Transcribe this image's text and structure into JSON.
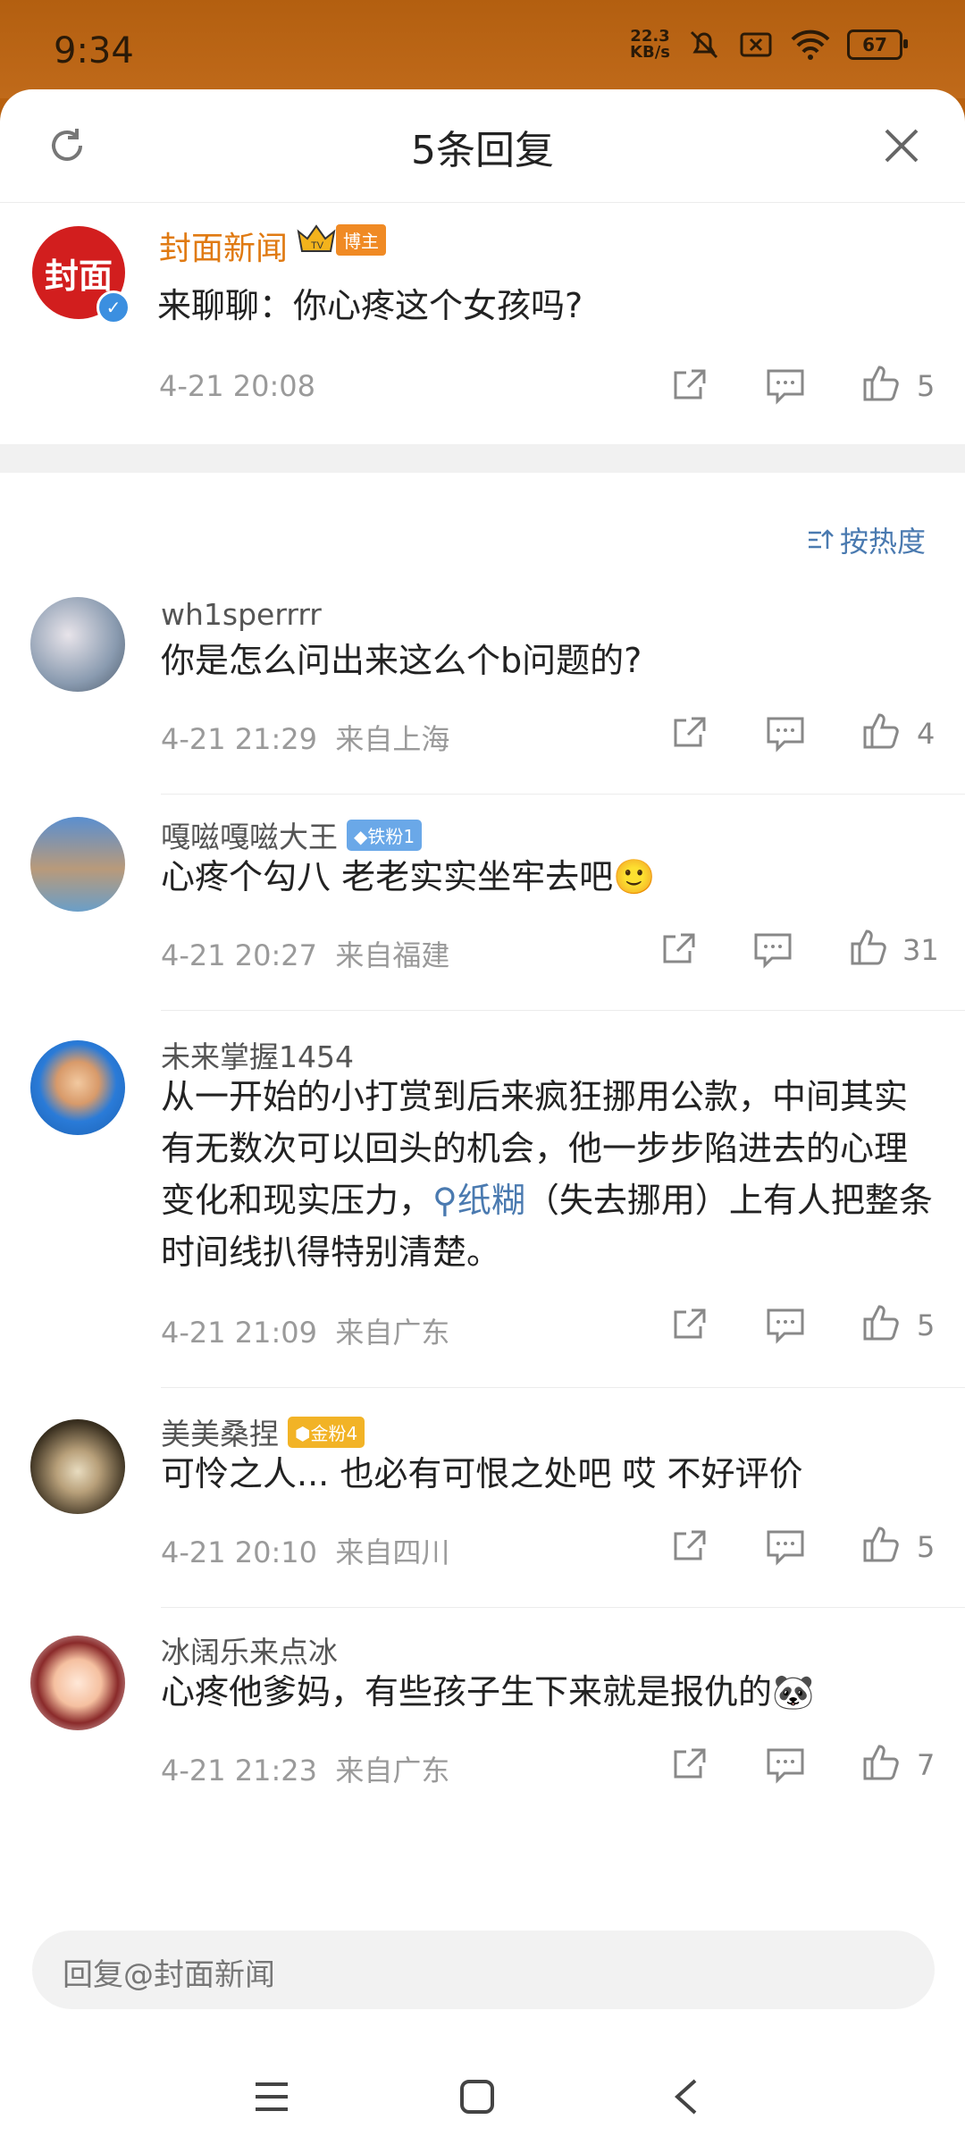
{
  "status": {
    "time": "9:34",
    "net_speed_top": "22.3",
    "net_speed_bottom": "KB/s",
    "battery": "67",
    "signal": "6"
  },
  "header": {
    "title": "5条回复"
  },
  "main_post": {
    "author": "封面新闻",
    "avatar_text": "封面",
    "badge": "博主",
    "text": "来聊聊：你心疼这个女孩吗?",
    "time": "4-21 20:08",
    "likes": "5"
  },
  "sort": {
    "label": "按热度"
  },
  "comments": [
    {
      "name": "wh1sperrrr",
      "badge": "",
      "text": "你是怎么问出来这么个b问题的?",
      "time": "4-21 21:29",
      "location": "来自上海",
      "likes": "4"
    },
    {
      "name": "嘎嗞嘎嗞大王",
      "badge": "铁粉1",
      "text": "心疼个勾八 老老实实坐牢去吧",
      "emoji": "🙂",
      "time": "4-21 20:27",
      "location": "来自福建",
      "likes": "31"
    },
    {
      "name": "未来掌握1454",
      "badge": "",
      "text_part1": "从一开始的小打赏到后来疯狂挪用公款，中间其实有无数次可以回头的机会，他一步步陷进去的心理变化和现实压力，",
      "link": "纸糊",
      "text_part2": "（失去挪用）上有人把整条时间线扒得特别清楚。",
      "time": "4-21 21:09",
      "location": "来自广东",
      "likes": "5"
    },
    {
      "name": "美美桑捏",
      "badge": "金粉4",
      "text": "可怜之人... 也必有可恨之处吧 哎 不好评价",
      "time": "4-21 20:10",
      "location": "来自四川",
      "likes": "5"
    },
    {
      "name": "冰阔乐来点冰",
      "badge": "",
      "text": "心疼他爹妈，有些孩子生下来就是报仇的",
      "emoji": "🐼",
      "time": "4-21 21:23",
      "location": "来自广东",
      "likes": "7"
    }
  ],
  "reply": {
    "placeholder": "回复@封面新闻"
  },
  "colors": {
    "accent_orange": "#e07a12",
    "link_blue": "#4a7ab0",
    "status_bar": "#b8600e"
  }
}
